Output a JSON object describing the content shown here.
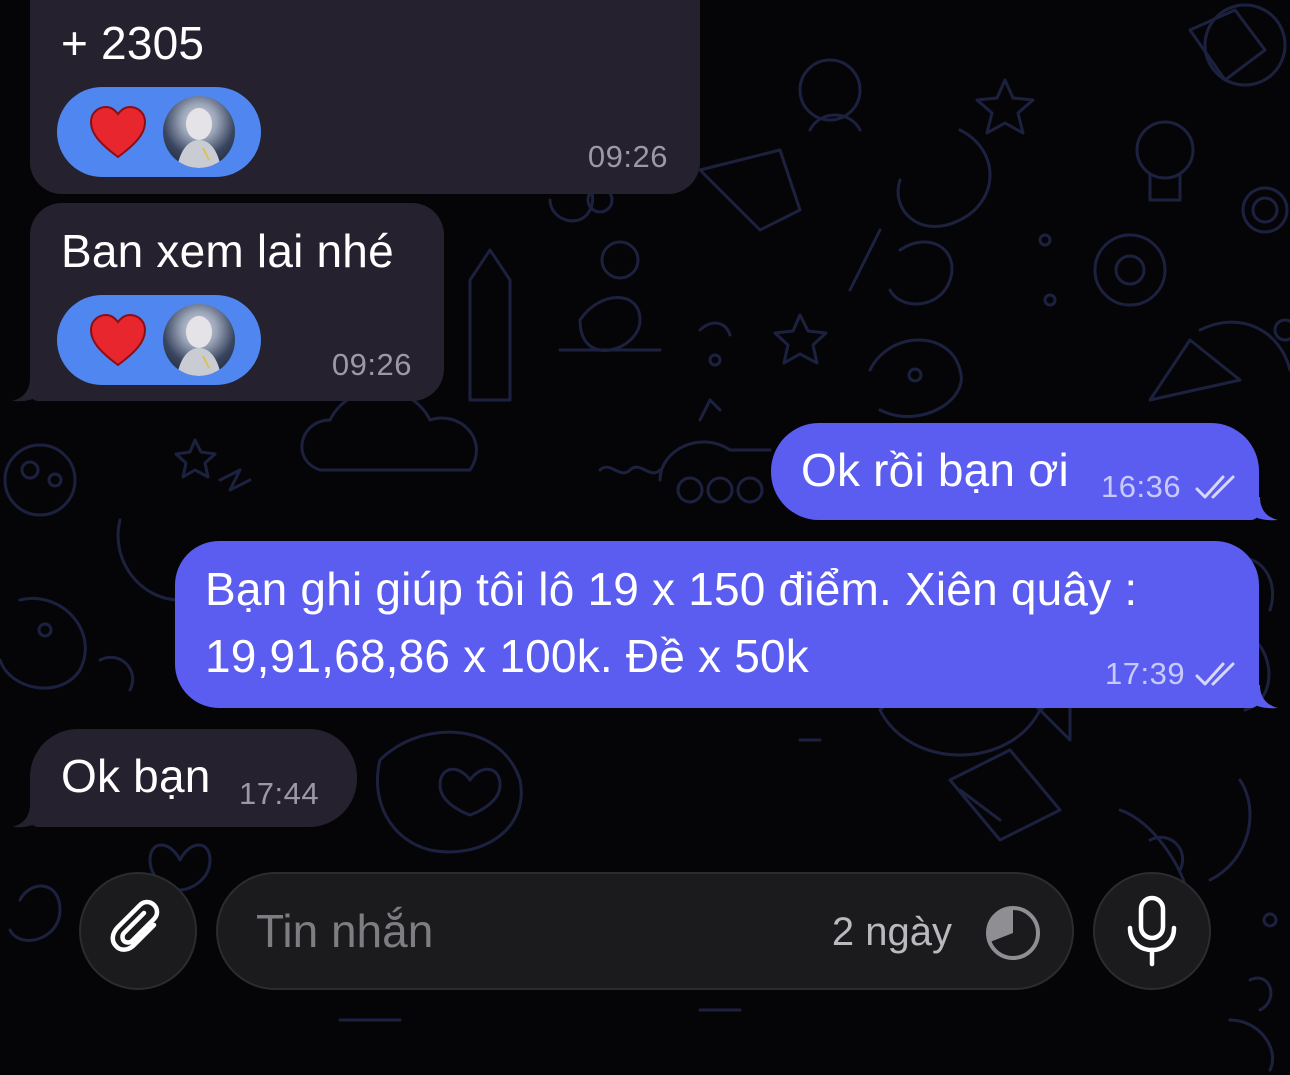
{
  "chat": {
    "messages": [
      {
        "direction": "incoming",
        "text": "+ 2305",
        "time": "09:26",
        "reactions": [
          "heart",
          "avatar"
        ]
      },
      {
        "direction": "incoming",
        "text": "Ban xem lai nhé",
        "time": "09:26",
        "reactions": [
          "heart",
          "avatar"
        ]
      },
      {
        "direction": "outgoing",
        "text": "Ok rồi bạn ơi",
        "time": "16:36",
        "status": "read"
      },
      {
        "direction": "outgoing",
        "text_line1": "Bạn ghi giúp tôi lô 19 x 150 điểm. Xiên quây :",
        "text_line2": "19,91,68,86 x 100k. Đề x 50k",
        "time": "17:39",
        "status": "read"
      },
      {
        "direction": "incoming",
        "text": "Ok bạn",
        "time": "17:44"
      }
    ]
  },
  "composer": {
    "placeholder": "Tin nhắn",
    "timer_label": "2 ngày",
    "icons": {
      "attach": "paperclip-icon",
      "timer": "self-destruct-timer-icon",
      "mic": "microphone-icon"
    }
  },
  "colors": {
    "incoming_bubble": "#25212f",
    "outgoing_bubble": "#5b5cf0",
    "reaction_pill": "#4f86f0",
    "background": "#050507"
  }
}
